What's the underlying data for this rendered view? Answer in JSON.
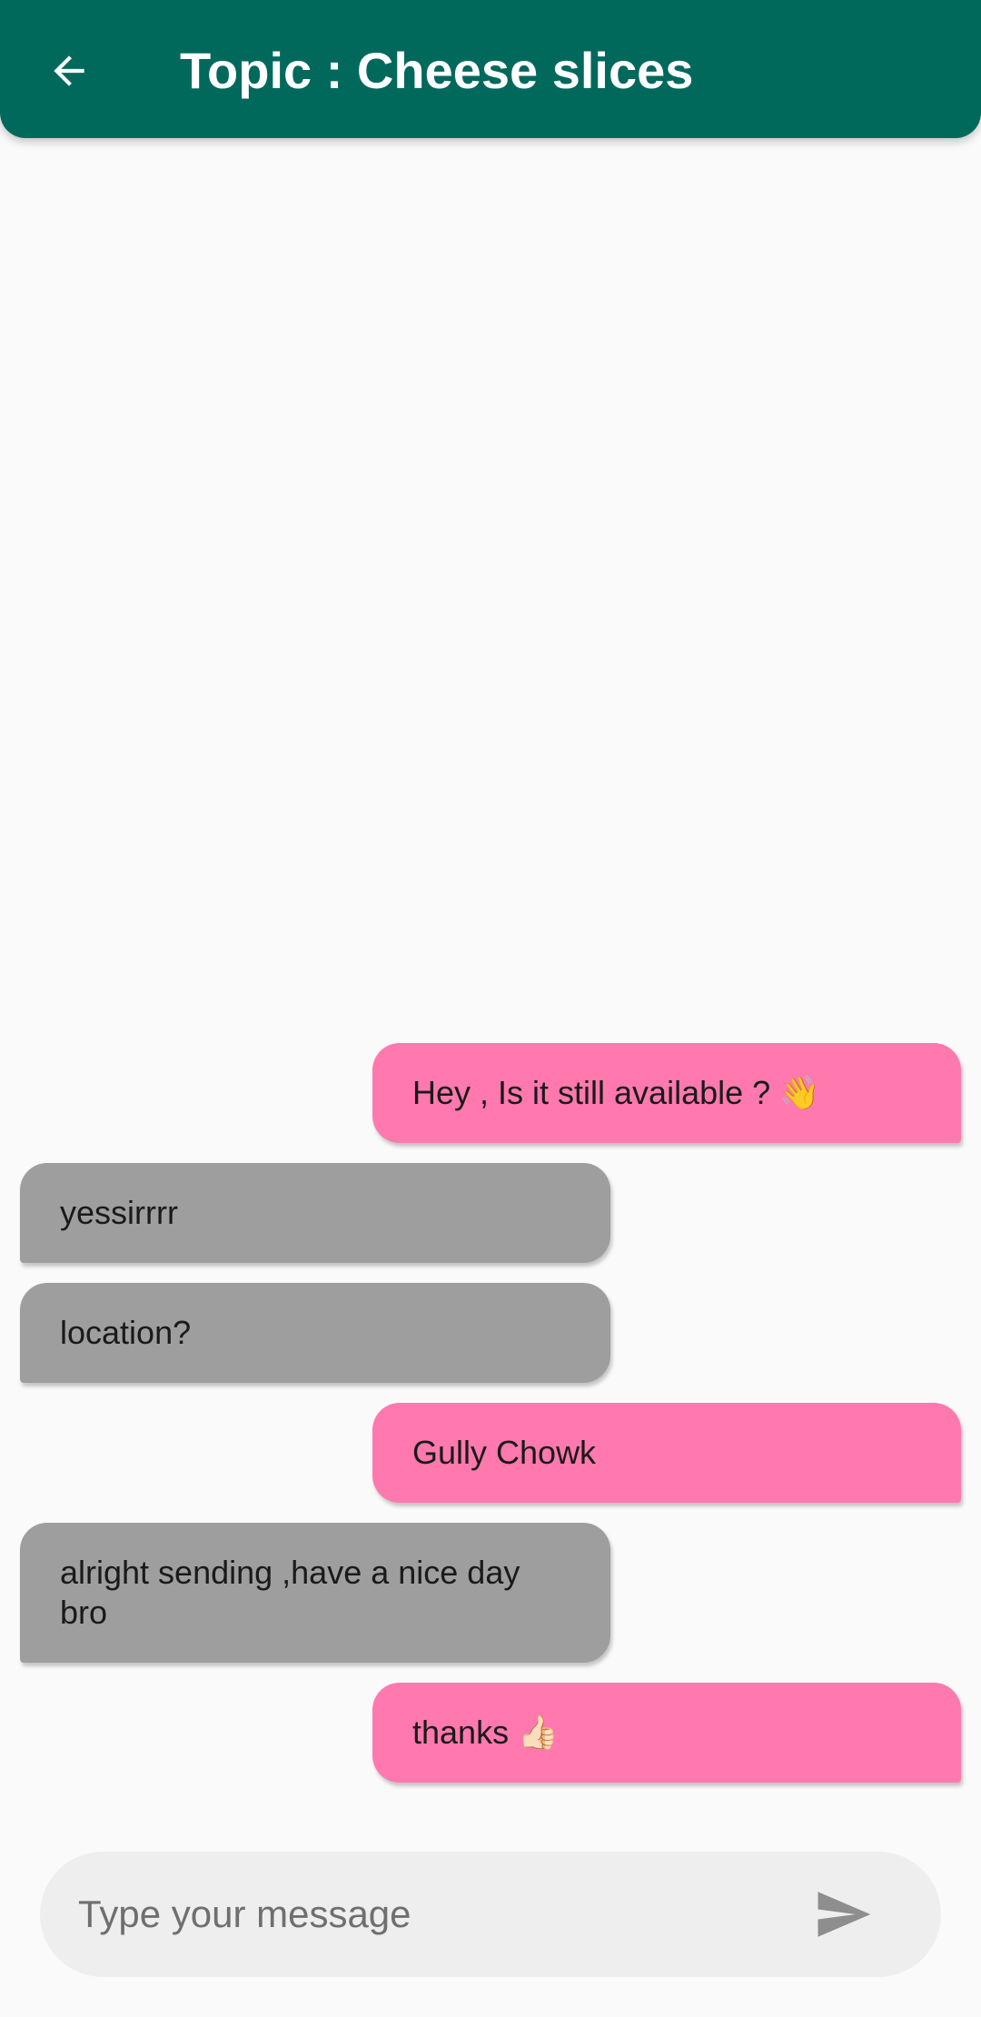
{
  "app_bar": {
    "title": "Topic : Cheese slices",
    "back_icon": "arrow-left-icon",
    "background_color": "#00695c"
  },
  "messages": [
    {
      "side": "sent",
      "text": "Hey , Is it still available ? 👋"
    },
    {
      "side": "received",
      "text": "yessirrrr"
    },
    {
      "side": "received",
      "text": "location?"
    },
    {
      "side": "sent",
      "text": "Gully Chowk"
    },
    {
      "side": "received",
      "text": "alright sending ,have a nice day bro"
    },
    {
      "side": "sent",
      "text": "thanks 👍🏻"
    }
  ],
  "composer": {
    "placeholder": "Type your message",
    "value": "",
    "send_icon": "send-icon"
  },
  "colors": {
    "sent_bubble": "#ff79ae",
    "received_bubble": "#9e9e9e",
    "background": "#fafafa"
  }
}
